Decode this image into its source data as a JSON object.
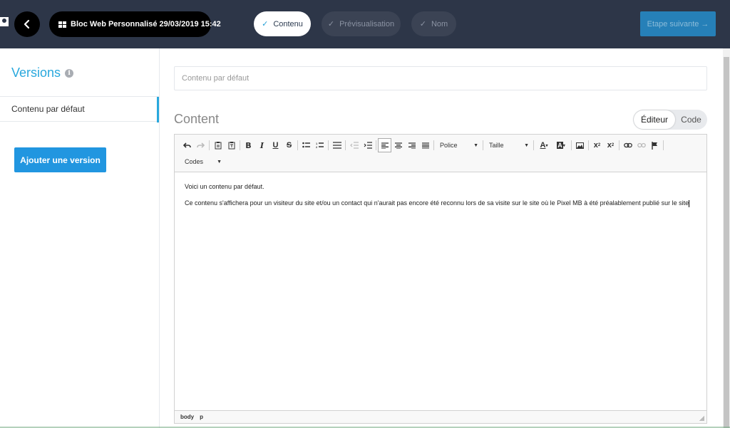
{
  "header": {
    "back_icon": "chevron-left-icon",
    "block_title": "Bloc Web Personnalisé 29/03/2019 15:42",
    "steps": [
      {
        "label": "Contenu",
        "state": "active"
      },
      {
        "label": "Prévisualisation",
        "state": "inactive"
      },
      {
        "label": "Nom",
        "state": "inactive"
      }
    ],
    "next_label": "Etape suivante",
    "next_arrow": "→"
  },
  "sidebar": {
    "title": "Versions",
    "info": "i",
    "items": [
      {
        "label": "Contenu par défaut",
        "selected": true
      }
    ],
    "add_button": "Ajouter une version"
  },
  "main": {
    "content_name_placeholder": "Contenu par défaut",
    "section_title": "Content",
    "mode_toggle": {
      "editor": "Éditeur",
      "code": "Code",
      "selected": "Éditeur"
    },
    "toolbar": {
      "font_label": "Police",
      "size_label": "Taille",
      "codes_label": "Codes"
    },
    "editor_text": [
      "Voici un contenu par défaut.",
      "Ce contenu s'affichera pour un visiteur du site et/ou un contact qui n'aurait pas encore été reconnu lors de sa visite sur le site où le Pixel MB à été préalablement publié sur le site"
    ],
    "status_path": [
      "body",
      "p"
    ]
  },
  "colors": {
    "topbar": "#2d3648",
    "accent": "#29a8dd",
    "primary_button": "#2196e0",
    "next_button": "#2680b8"
  }
}
